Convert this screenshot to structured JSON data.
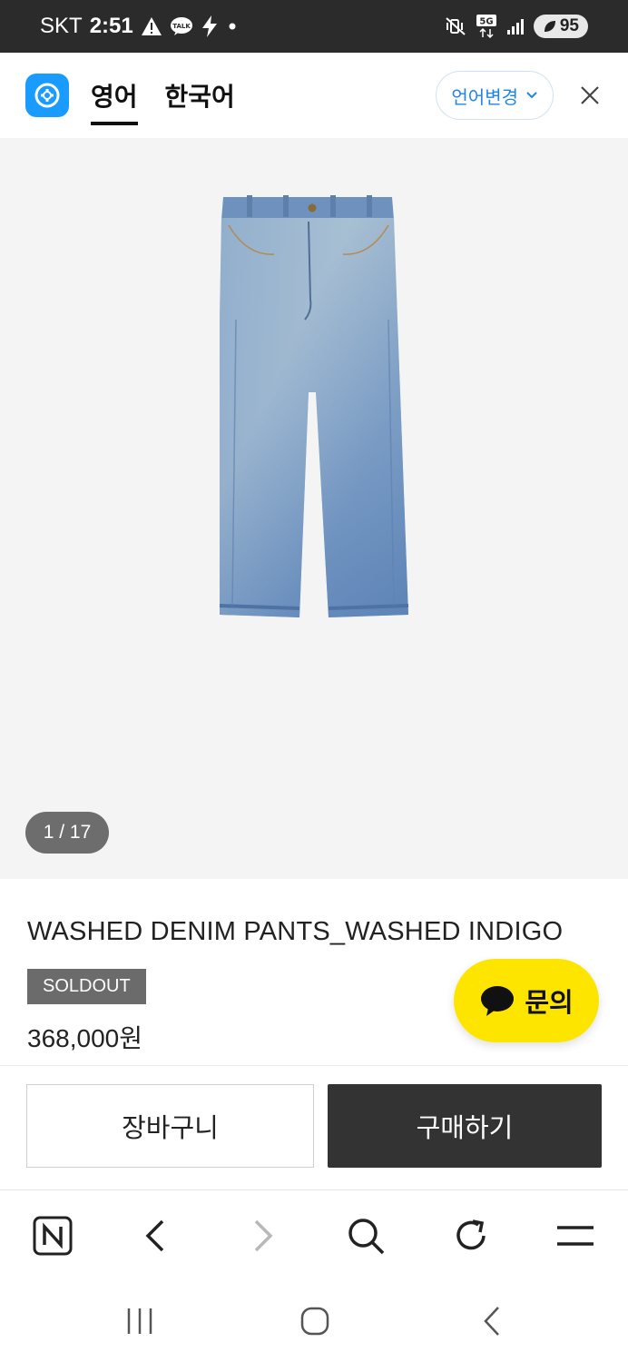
{
  "status_bar": {
    "carrier": "SKT",
    "time": "2:51",
    "network": "5G",
    "battery": "95"
  },
  "translate_bar": {
    "tabs": [
      {
        "label": "영어",
        "active": true
      },
      {
        "label": "한국어",
        "active": false
      }
    ],
    "change_language_label": "언어변경",
    "accent_color": "#1f86e6"
  },
  "gallery": {
    "counter": "1 / 17"
  },
  "product": {
    "title": "WASHED DENIM PANTS_WASHED INDIGO",
    "badge": "SOLDOUT",
    "price": "368,000원"
  },
  "inquiry_button": {
    "label": "문의",
    "color": "#fee500"
  },
  "actions": {
    "cart_label": "장바구니",
    "buy_label": "구매하기"
  },
  "browser_toolbar": {
    "items": [
      "naver-icon",
      "back-icon",
      "forward-icon",
      "search-icon",
      "refresh-icon",
      "menu-icon"
    ]
  },
  "system_nav": {
    "items": [
      "recent-apps-icon",
      "home-icon",
      "system-back-icon"
    ]
  }
}
